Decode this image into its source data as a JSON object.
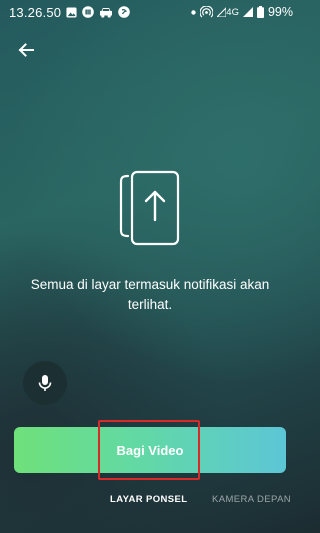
{
  "status_bar": {
    "time": "13.26.50",
    "network": "4G",
    "battery": "99%",
    "icons": [
      "image-icon",
      "media-icon",
      "car-icon",
      "notification-icon",
      "dot-icon",
      "hotspot-icon",
      "signal-icon",
      "battery-icon"
    ]
  },
  "header": {
    "back_icon": "arrow-left-icon"
  },
  "content": {
    "illustration_icon": "share-screen-icon",
    "message": "Semua di layar termasuk notifikasi akan terlihat."
  },
  "controls": {
    "mic_icon": "microphone-icon",
    "share_button_label": "Bagi Video",
    "share_button_gradient": [
      "#6fe07a",
      "#5cc6d6"
    ],
    "highlight_color": "#d92a2a"
  },
  "mode_tabs": [
    {
      "label": "LAYAR PONSEL",
      "active": true
    },
    {
      "label": "KAMERA DEPAN",
      "active": false
    }
  ]
}
